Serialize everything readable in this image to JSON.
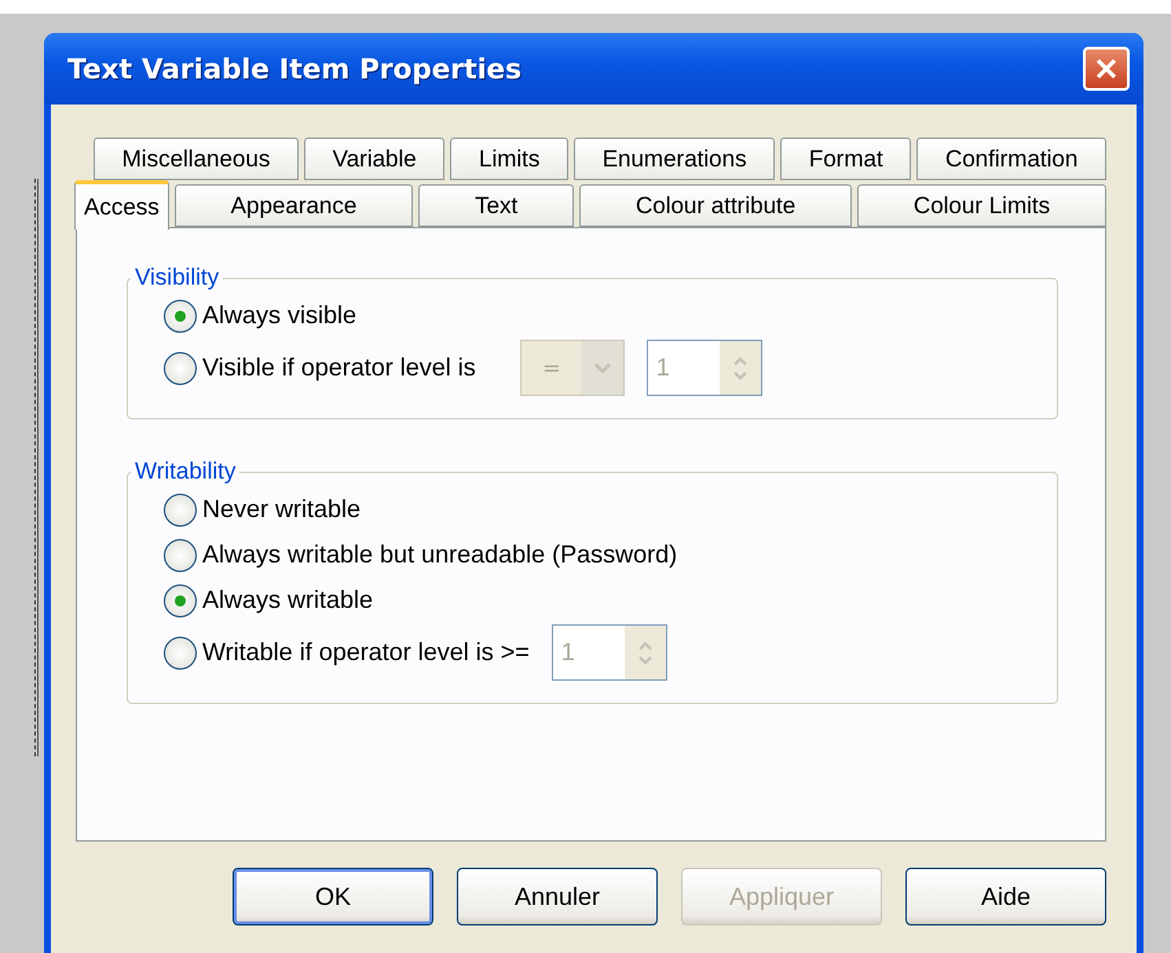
{
  "window": {
    "title": "Text Variable Item Properties"
  },
  "tab_rows": [
    [
      {
        "label": "Miscellaneous",
        "selected": false
      },
      {
        "label": "Variable",
        "selected": false
      },
      {
        "label": "Limits",
        "selected": false
      },
      {
        "label": "Enumerations",
        "selected": false
      },
      {
        "label": "Format",
        "selected": false
      },
      {
        "label": "Confirmation",
        "selected": false
      }
    ],
    [
      {
        "label": "Access",
        "selected": true
      },
      {
        "label": "Appearance",
        "selected": false
      },
      {
        "label": "Text",
        "selected": false
      },
      {
        "label": "Colour attribute",
        "selected": false
      },
      {
        "label": "Colour Limits",
        "selected": false
      }
    ]
  ],
  "groups": [
    {
      "title": "Visibility",
      "options": [
        {
          "label": "Always visible",
          "selected": true
        },
        {
          "label": "Visible if operator level is",
          "selected": false,
          "controls": [
            {
              "kind": "combo",
              "value": "=",
              "disabled": true
            },
            {
              "kind": "spin",
              "value": "1",
              "disabled": true
            }
          ]
        }
      ]
    },
    {
      "title": "Writability",
      "options": [
        {
          "label": "Never writable",
          "selected": false
        },
        {
          "label": "Always writable but unreadable (Password)",
          "selected": false
        },
        {
          "label": "Always writable",
          "selected": true
        },
        {
          "label": "Writable if operator level is >=",
          "selected": false,
          "controls": [
            {
              "kind": "spin",
              "value": "1",
              "disabled": true
            }
          ]
        }
      ]
    }
  ],
  "buttons": [
    {
      "label": "OK",
      "disabled": false,
      "default": true
    },
    {
      "label": "Annuler",
      "disabled": false,
      "default": false
    },
    {
      "label": "Appliquer",
      "disabled": true,
      "default": false
    },
    {
      "label": "Aide",
      "disabled": false,
      "default": false
    }
  ]
}
